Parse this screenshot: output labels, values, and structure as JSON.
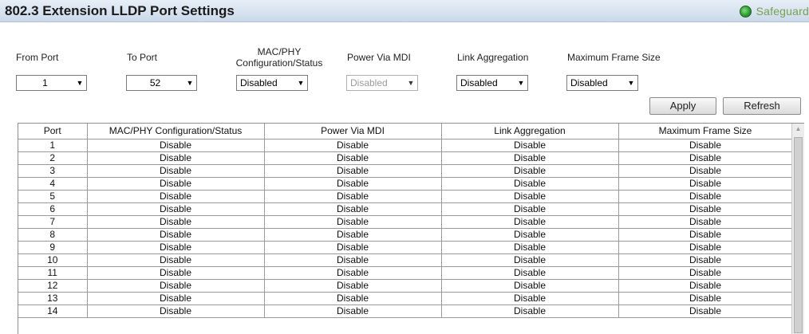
{
  "header": {
    "title": "802.3 Extension LLDP Port Settings",
    "safeguard": "Safeguard"
  },
  "form": {
    "from_port_label": "From Port",
    "to_port_label": "To Port",
    "macphy_label_line1": "MAC/PHY",
    "macphy_label_line2": "Configuration/Status",
    "power_label": "Power Via MDI",
    "link_agg_label": "Link Aggregation",
    "max_frame_label": "Maximum Frame Size",
    "from_port_value": "1",
    "to_port_value": "52",
    "macphy_value": "Disabled",
    "power_value": "Disabled",
    "link_agg_value": "Disabled",
    "max_frame_value": "Disabled",
    "apply_label": "Apply",
    "refresh_label": "Refresh"
  },
  "table": {
    "headers": [
      "Port",
      "MAC/PHY Configuration/Status",
      "Power Via MDI",
      "Link Aggregation",
      "Maximum Frame Size"
    ],
    "rows": [
      [
        "1",
        "Disable",
        "Disable",
        "Disable",
        "Disable"
      ],
      [
        "2",
        "Disable",
        "Disable",
        "Disable",
        "Disable"
      ],
      [
        "3",
        "Disable",
        "Disable",
        "Disable",
        "Disable"
      ],
      [
        "4",
        "Disable",
        "Disable",
        "Disable",
        "Disable"
      ],
      [
        "5",
        "Disable",
        "Disable",
        "Disable",
        "Disable"
      ],
      [
        "6",
        "Disable",
        "Disable",
        "Disable",
        "Disable"
      ],
      [
        "7",
        "Disable",
        "Disable",
        "Disable",
        "Disable"
      ],
      [
        "8",
        "Disable",
        "Disable",
        "Disable",
        "Disable"
      ],
      [
        "9",
        "Disable",
        "Disable",
        "Disable",
        "Disable"
      ],
      [
        "10",
        "Disable",
        "Disable",
        "Disable",
        "Disable"
      ],
      [
        "11",
        "Disable",
        "Disable",
        "Disable",
        "Disable"
      ],
      [
        "12",
        "Disable",
        "Disable",
        "Disable",
        "Disable"
      ],
      [
        "13",
        "Disable",
        "Disable",
        "Disable",
        "Disable"
      ],
      [
        "14",
        "Disable",
        "Disable",
        "Disable",
        "Disable"
      ]
    ]
  }
}
